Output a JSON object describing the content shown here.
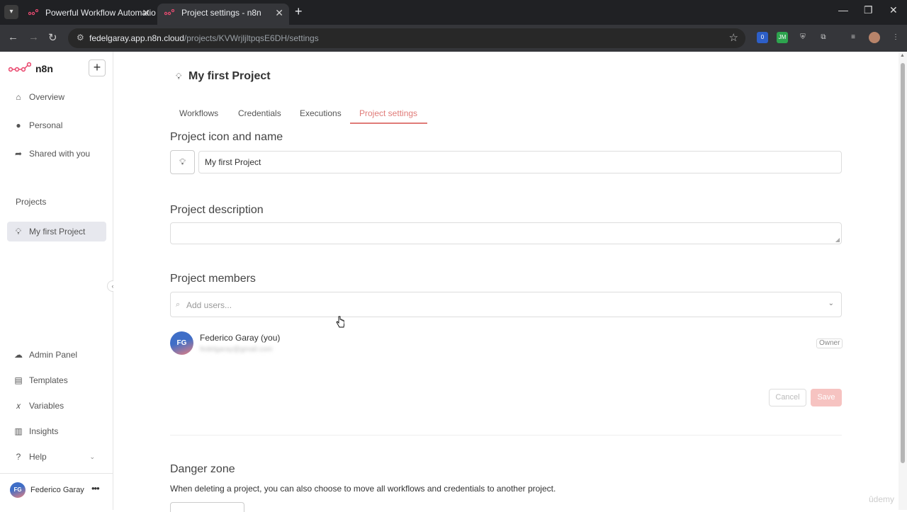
{
  "browser": {
    "tabs": [
      {
        "title": "Powerful Workflow Automation"
      },
      {
        "title": "Project settings - n8n"
      }
    ],
    "url_host": "fedelgaray.app.n8n.cloud",
    "url_path": "/projects/KVWrjljltpqsE6DH/settings",
    "extension_badge": "0",
    "extension_label": "JM"
  },
  "sidebar": {
    "brand": "n8n",
    "nav": [
      {
        "label": "Overview",
        "icon": "home-icon"
      },
      {
        "label": "Personal",
        "icon": "user-icon"
      },
      {
        "label": "Shared with you",
        "icon": "share-icon"
      }
    ],
    "projects_label": "Projects",
    "project_items": [
      {
        "label": "My first Project",
        "icon": "lightbulb-icon"
      }
    ],
    "bottom_nav": [
      {
        "label": "Admin Panel",
        "icon": "cloud-icon"
      },
      {
        "label": "Templates",
        "icon": "template-icon"
      },
      {
        "label": "Variables",
        "icon": "variable-icon"
      },
      {
        "label": "Insights",
        "icon": "chart-icon"
      },
      {
        "label": "Help",
        "icon": "question-icon"
      }
    ],
    "user": {
      "initials": "FG",
      "name": "Federico Garay"
    }
  },
  "main": {
    "title": "My first Project",
    "tabs": [
      "Workflows",
      "Credentials",
      "Executions",
      "Project settings"
    ],
    "active_tab": "Project settings",
    "icon_name_title": "Project icon and name",
    "name_value": "My first Project",
    "description_title": "Project description",
    "description_value": "",
    "members_title": "Project members",
    "members_placeholder": "Add users...",
    "members": [
      {
        "initials": "FG",
        "name": "Federico Garay (you)",
        "email": "fedelgaray@gmail.com",
        "role": "Owner"
      }
    ],
    "cancel_label": "Cancel",
    "save_label": "Save",
    "danger_title": "Danger zone",
    "danger_text": "When deleting a project, you can also choose to move all workflows and credentials to another project."
  },
  "watermark": "ûdemy",
  "colors": {
    "accent": "#e07b78",
    "save_disabled": "#f6c3c1"
  }
}
